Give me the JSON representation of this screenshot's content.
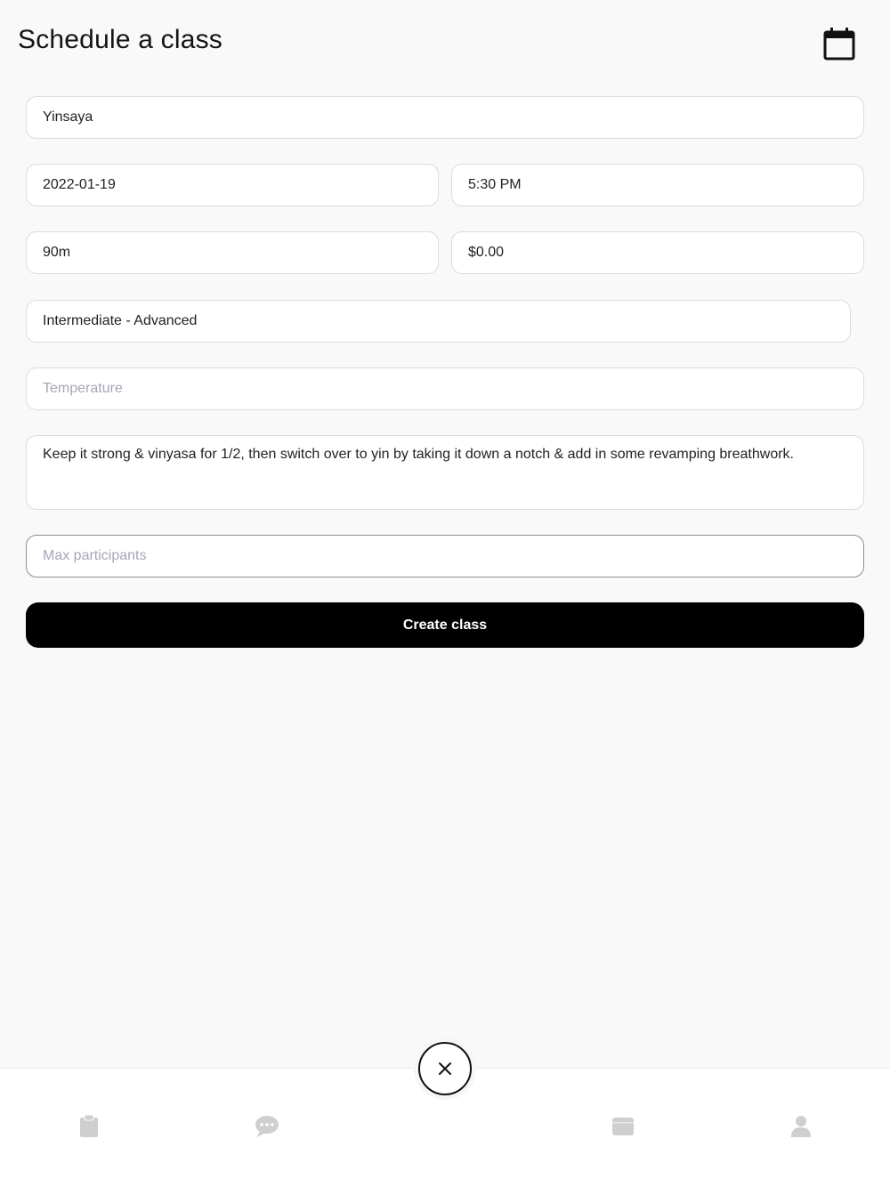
{
  "header": {
    "title": "Schedule a class",
    "calendar_icon": "calendar-icon"
  },
  "form": {
    "class_name": {
      "value": "Yinsaya",
      "placeholder": ""
    },
    "date": {
      "value": "2022-01-19"
    },
    "time": {
      "value": "5:30 PM"
    },
    "duration": {
      "value": "90m"
    },
    "price": {
      "value": "$0.00"
    },
    "level": {
      "value": "Intermediate - Advanced"
    },
    "temperature": {
      "value": "",
      "placeholder": "Temperature"
    },
    "description": {
      "value": "Keep it strong & vinyasa for 1/2, then switch over to yin by taking it down a notch & add in some revamping breathwork."
    },
    "max_participants": {
      "value": "",
      "placeholder": "Max participants"
    },
    "submit_label": "Create class"
  },
  "tabbar": {
    "tabs": [
      {
        "icon": "clipboard-icon"
      },
      {
        "icon": "chat-icon"
      },
      {
        "icon": "wallet-icon"
      },
      {
        "icon": "user-icon"
      }
    ],
    "center_icon": "close-icon"
  },
  "colors": {
    "background": "#f9f9f9",
    "primary_button": "#000000",
    "tab_icon_inactive": "#cfcfcf",
    "placeholder": "#a8a4b6"
  }
}
